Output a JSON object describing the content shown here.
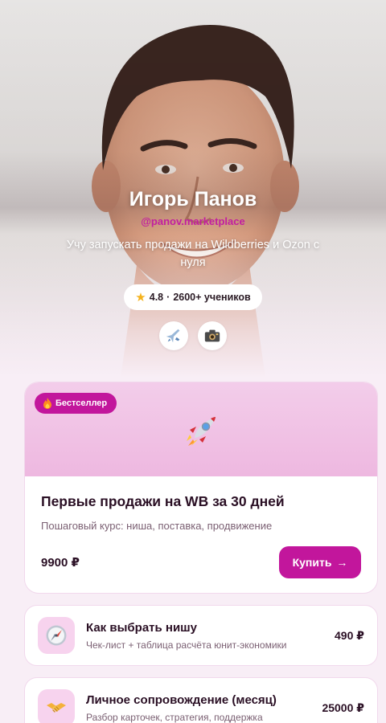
{
  "profile": {
    "name": "Игорь Панов",
    "handle": "@panov.marketplace",
    "tagline": "Учу запускать продажи на Wildberries и Ozon с нуля",
    "rating": "4.8",
    "rating_separator": "·",
    "students": "2600+ учеников",
    "socials": [
      {
        "icon": "telegram-plane-icon"
      },
      {
        "icon": "camera-icon"
      }
    ]
  },
  "featured": {
    "badge": "Бестселлер",
    "title": "Первые продажи на WB за 30 дней",
    "description": "Пошаговый курс: ниша, поставка, продвижение",
    "price": "9900 ₽",
    "buy_label": "Купить",
    "buy_arrow": "→"
  },
  "products": [
    {
      "icon": "compass-icon",
      "title": "Как выбрать нишу",
      "description": "Чек-лист + таблица расчёта юнит-экономики",
      "price": "490 ₽"
    },
    {
      "icon": "handshake-icon",
      "title": "Личное сопровождение (месяц)",
      "description": "Разбор карточек, стратегия, поддержка",
      "price": "25000 ₽"
    }
  ],
  "colors": {
    "accent": "#c2169c",
    "banner": "#f3cdea",
    "icon_bg": "#f7d3ee",
    "text": "#2a0f24",
    "muted": "#7a5f72"
  }
}
